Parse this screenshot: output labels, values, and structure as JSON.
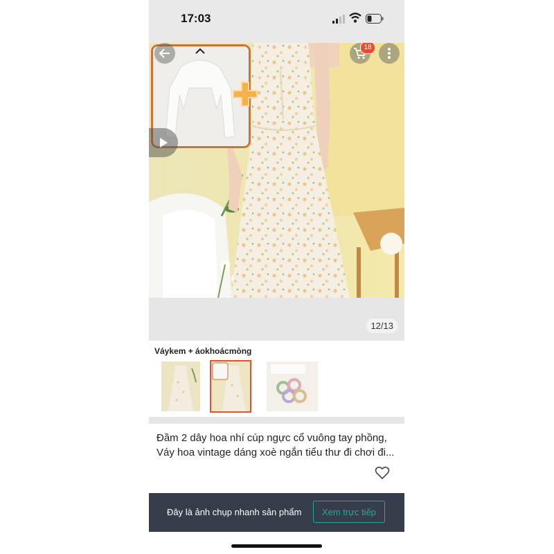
{
  "status_bar": {
    "time": "17:03"
  },
  "top_actions": {
    "cart_badge": "18"
  },
  "gallery": {
    "counter": "12/13"
  },
  "variant": {
    "title": "Váykem + áokhoácmòng",
    "thumbnails": [
      "dress-front",
      "dress-with-cardigan",
      "hair-ties"
    ]
  },
  "product": {
    "description_line1": "Đầm 2 dây hoa nhí cúp ngực cổ vuông tay phồng,",
    "description_line2": "Váy hoa vintage dáng xoè ngắn tiểu thư đi chơi đi..."
  },
  "banner": {
    "text": "Đây là ảnh chụp nhanh sản phẩm",
    "button_label": "Xem trực tiếp"
  },
  "colors": {
    "accent": "#ee4d2d",
    "banner_bg": "#353c4a",
    "live_button": "#26aa99"
  }
}
